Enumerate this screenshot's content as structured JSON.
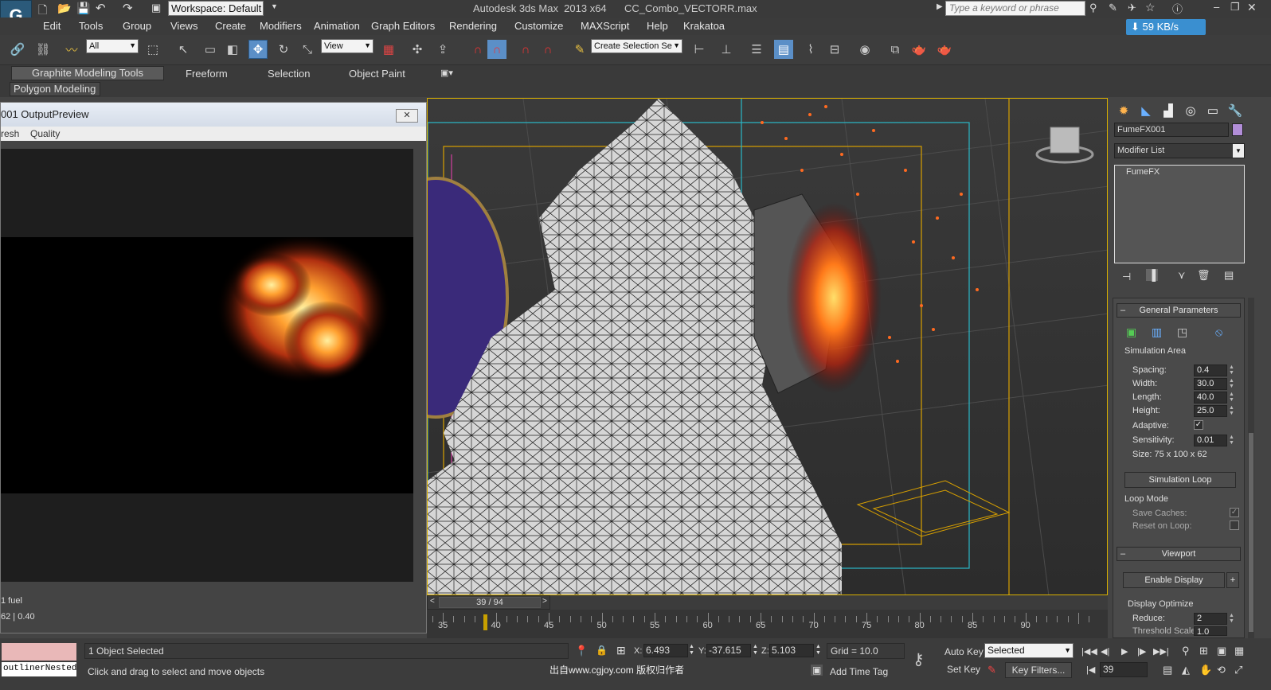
{
  "titlebar": {
    "workspace": "Workspace: Default",
    "app_title": "Autodesk 3ds Max  2013 x64",
    "file_name": "CC_Combo_VECTORR.max",
    "search_placeholder": "Type a keyword or phrase",
    "speed_badge": "59 KB/s"
  },
  "menu": [
    "Edit",
    "Tools",
    "Group",
    "Views",
    "Create",
    "Modifiers",
    "Animation",
    "Graph Editors",
    "Rendering",
    "Customize",
    "MAXScript",
    "Help",
    "Krakatoa"
  ],
  "toolbar": {
    "filter_value": "All",
    "ref_coord_value": "View",
    "selection_set_placeholder": "Create Selection Se"
  },
  "ribbon": {
    "tabs": [
      "Graphite Modeling Tools",
      "Freeform",
      "Selection",
      "Object Paint"
    ],
    "sub_label": "Polygon Modeling"
  },
  "output_window": {
    "title": "001 OutputPreview",
    "menu": [
      "resh",
      "Quality"
    ],
    "footer_line1": "1 fuel",
    "footer_line2": "62 | 0.40"
  },
  "command_panel": {
    "object_name": "FumeFX001",
    "object_color": "#b28ed8",
    "modifier_list": "Modifier List",
    "stack_item": "FumeFX",
    "general_rollout": "General Parameters",
    "sim_area_group": "Simulation Area",
    "params": [
      {
        "label": "Spacing:",
        "value": "0.4"
      },
      {
        "label": "Width:",
        "value": "30.0"
      },
      {
        "label": "Length:",
        "value": "40.0"
      },
      {
        "label": "Height:",
        "value": "25.0"
      }
    ],
    "adaptive_label": "Adaptive:",
    "sensitivity_label": "Sensitivity:",
    "sensitivity_value": "0.01",
    "size_text": "Size:  75 x 100 x 62",
    "sim_loop_button": "Simulation Loop",
    "loop_mode_group": "Loop Mode",
    "save_caches": "Save Caches:",
    "reset_on_loop": "Reset on Loop:",
    "viewport_rollout": "Viewport",
    "enable_display": "Enable Display",
    "display_optimize": "Display Optimize",
    "reduce_label": "Reduce:",
    "reduce_value": "2",
    "threshold_label": "Threshold Scale:",
    "threshold_value": "1.0"
  },
  "timeline": {
    "frame_text": "39 / 94",
    "current_frame": 39,
    "ticks": [
      "35",
      "40",
      "45",
      "50",
      "55",
      "60",
      "65",
      "70",
      "75",
      "80",
      "85",
      "90"
    ]
  },
  "status": {
    "maxscript_field": "outlinerNested",
    "selected_text": "1 Object Selected",
    "prompt_text": "Click and drag to select and move objects",
    "x_label": "X:",
    "x_value": "6.493",
    "y_label": "Y:",
    "y_value": "-37.615",
    "z_label": "Z:",
    "z_value": "5.103",
    "grid": "Grid = 10.0",
    "watermark": "出自www.cgjoy.com 版权归作者",
    "add_time_tag": "Add Time Tag",
    "auto_key": "Auto Key",
    "set_key": "Set Key",
    "key_mode": "Selected",
    "key_filters": "Key Filters...",
    "frame_field": "39"
  }
}
